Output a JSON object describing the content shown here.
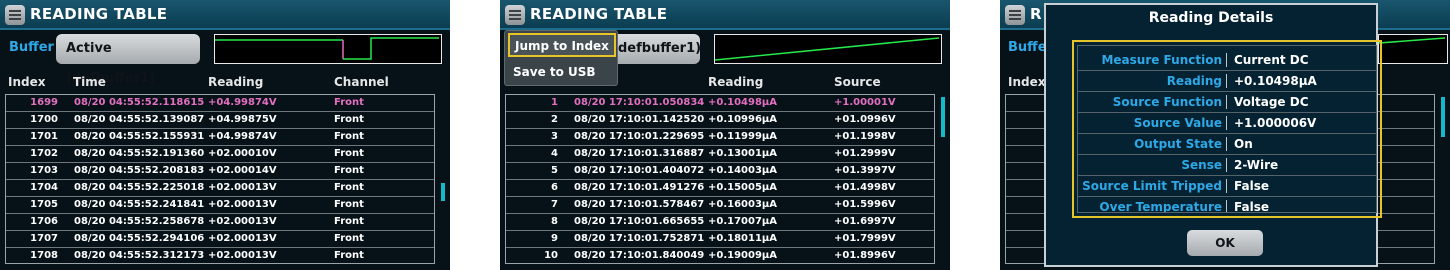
{
  "panels": [
    {
      "title": "READING TABLE",
      "buffer_label": "Buffer",
      "buffer_button": "Active (defbuffer1)",
      "headers": [
        "Index",
        "Time",
        "Reading",
        "Channel"
      ],
      "rows": [
        [
          "1699",
          "08/20 04:55:52.118615",
          "+04.99874V",
          "Front"
        ],
        [
          "1700",
          "08/20 04:55:52.139087",
          "+04.99875V",
          "Front"
        ],
        [
          "1701",
          "08/20 04:55:52.155931",
          "+04.99874V",
          "Front"
        ],
        [
          "1702",
          "08/20 04:55:52.191360",
          "+02.00010V",
          "Front"
        ],
        [
          "1703",
          "08/20 04:55:52.208183",
          "+02.00014V",
          "Front"
        ],
        [
          "1704",
          "08/20 04:55:52.225018",
          "+02.00013V",
          "Front"
        ],
        [
          "1705",
          "08/20 04:55:52.241841",
          "+02.00013V",
          "Front"
        ],
        [
          "1706",
          "08/20 04:55:52.258678",
          "+02.00013V",
          "Front"
        ],
        [
          "1707",
          "08/20 04:55:52.294106",
          "+02.00013V",
          "Front"
        ],
        [
          "1708",
          "08/20 04:55:52.312173",
          "+02.00013V",
          "Front"
        ]
      ]
    },
    {
      "title": "READING TABLE",
      "buffer_button": "Active (defbuffer1)",
      "buffer_button_visible": "defbuffer1)",
      "menu": {
        "jump_to_index": "Jump to Index",
        "save_to_usb": "Save to USB"
      },
      "headers": [
        "Index",
        "Time",
        "Reading",
        "Source"
      ],
      "rows": [
        [
          "1",
          "08/20 17:10:01.050834",
          "+0.10498µA",
          "+1.00001V"
        ],
        [
          "2",
          "08/20 17:10:01.142520",
          "+0.10996µA",
          "+01.0996V"
        ],
        [
          "3",
          "08/20 17:10:01.229695",
          "+0.11999µA",
          "+01.1998V"
        ],
        [
          "4",
          "08/20 17:10:01.316887",
          "+0.13001µA",
          "+01.2999V"
        ],
        [
          "5",
          "08/20 17:10:01.404072",
          "+0.14003µA",
          "+01.3997V"
        ],
        [
          "6",
          "08/20 17:10:01.491276",
          "+0.15005µA",
          "+01.4998V"
        ],
        [
          "7",
          "08/20 17:10:01.578467",
          "+0.16003µA",
          "+01.5996V"
        ],
        [
          "8",
          "08/20 17:10:01.665655",
          "+0.17007µA",
          "+01.6997V"
        ],
        [
          "9",
          "08/20 17:10:01.752871",
          "+0.18011µA",
          "+01.7999V"
        ],
        [
          "10",
          "08/20 17:10:01.840049",
          "+0.19009µA",
          "+01.8996V"
        ]
      ]
    },
    {
      "title_visible": "R",
      "buffer_label_visible": "Buffe",
      "index_header": "Index",
      "dialog": {
        "title": "Reading Details",
        "fields": [
          {
            "label": "Measure Function",
            "value": "Current DC"
          },
          {
            "label": "Reading",
            "value": "+0.10498µA"
          },
          {
            "label": "Source Function",
            "value": "Voltage DC"
          },
          {
            "label": "Source Value",
            "value": "+1.000006V"
          },
          {
            "label": "Output State",
            "value": "On"
          },
          {
            "label": "Sense",
            "value": "2-Wire"
          },
          {
            "label": "Source Limit Tripped",
            "value": "False"
          },
          {
            "label": "Over Temperature",
            "value": "False"
          }
        ],
        "ok_label": "OK"
      }
    }
  ],
  "colors": {
    "accent_blue": "#2ea8e6",
    "highlight_row": "#e36fc0",
    "selection": "#e5c52a",
    "scrollbar": "#16b9c9",
    "trace": "#27e84a"
  }
}
